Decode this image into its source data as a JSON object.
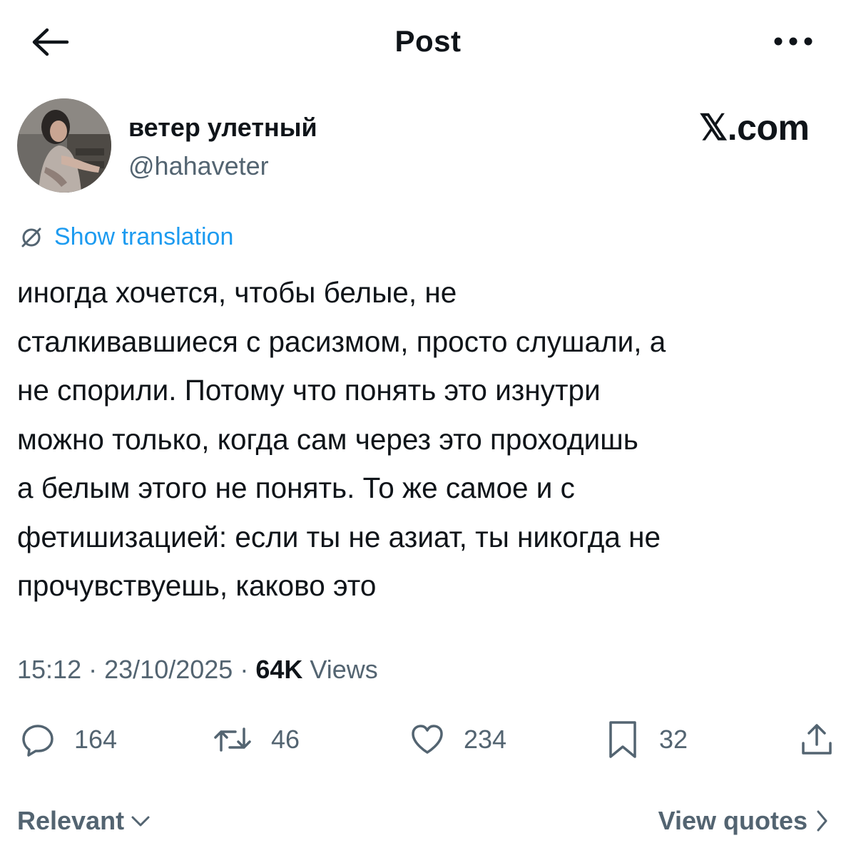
{
  "header": {
    "title": "Post"
  },
  "author": {
    "display_name": "ветер улетный",
    "handle": "@hahaveter",
    "source_label": "𝕏.com"
  },
  "translation": {
    "label": "Show translation"
  },
  "post": {
    "lines": [
      "иногда хочется, чтобы белые, не",
      "сталкивавшиеся с расизмом, просто слушали, а",
      "не спорили. Потому что понять это изнутри",
      "можно только, когда сам через это проходишь",
      "а белым этого не понять. То же самое и с",
      "фетишизацией: если ты не азиат, ты никогда не",
      "прочувствуешь, каково это"
    ]
  },
  "meta": {
    "time": "15:12",
    "date": "23/10/2025",
    "separator": "·",
    "views_count": "64K",
    "views_label": "Views"
  },
  "actions": {
    "replies": "164",
    "reposts": "46",
    "likes": "234",
    "bookmarks": "32"
  },
  "footer": {
    "sort_label": "Relevant",
    "quotes_label": "View quotes"
  },
  "colors": {
    "text": "#0f1419",
    "secondary": "#536471",
    "link": "#1d9bf0",
    "background": "#ffffff"
  }
}
